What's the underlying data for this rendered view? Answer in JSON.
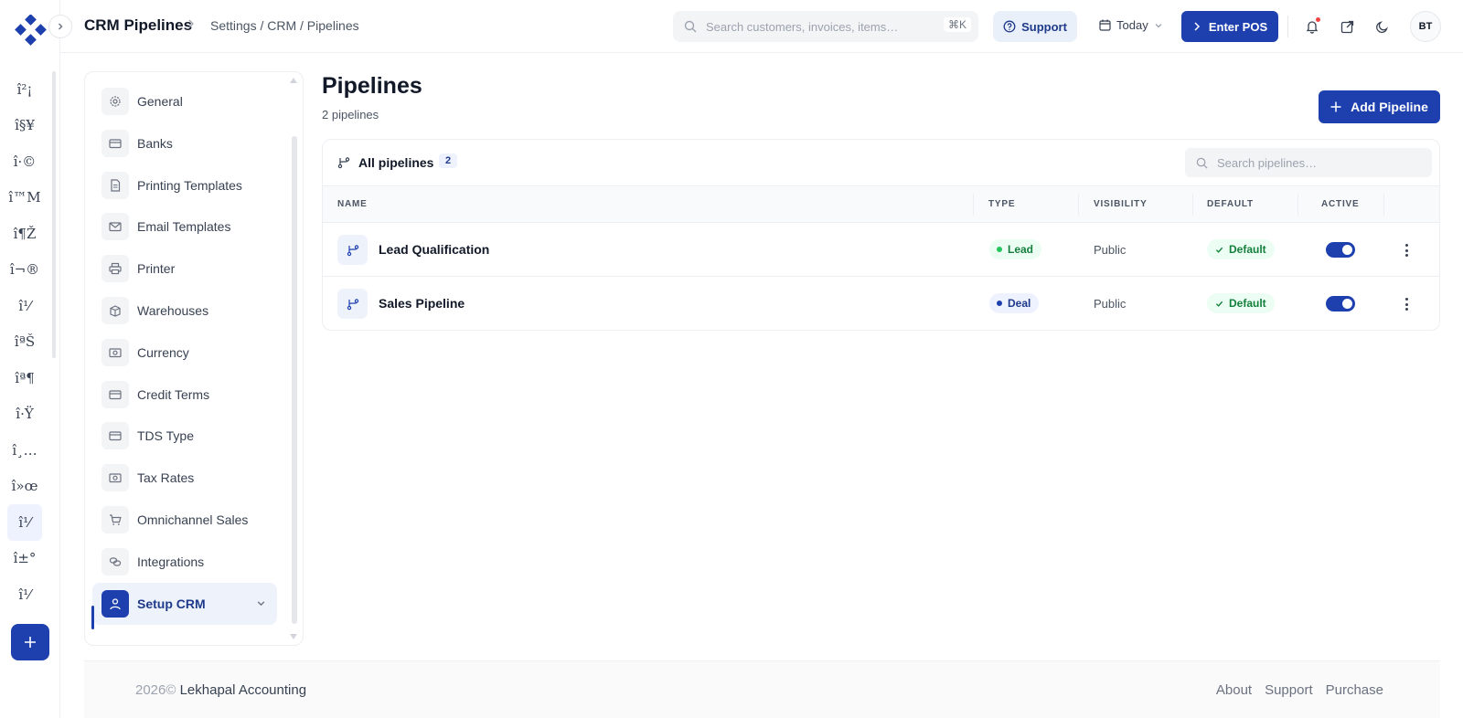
{
  "header": {
    "title": "CRM Pipelines",
    "breadcrumb": "Settings / CRM / Pipelines",
    "search_placeholder": "Search customers, invoices, items…",
    "search_shortcut": "⌘K",
    "support_label": "Support",
    "date_label": "Today",
    "pos_label": "Enter POS",
    "avatar_initials": "BT"
  },
  "rail": {
    "items": [
      "î²¡",
      "î§¥",
      "î·©",
      "î™M",
      "î¶Ž",
      "î¬®",
      "î¹⁄",
      "îªŠ",
      "îª¶",
      "î·Ÿ",
      "î¸…",
      "î»œ",
      "î¹⁄",
      "î±°",
      "î¹⁄"
    ],
    "active_index": 12
  },
  "settings_nav": {
    "items": [
      {
        "label": "General",
        "icon": "gear-icon"
      },
      {
        "label": "Banks",
        "icon": "card-icon"
      },
      {
        "label": "Printing Templates",
        "icon": "document-icon"
      },
      {
        "label": "Email Templates",
        "icon": "mail-icon"
      },
      {
        "label": "Printer",
        "icon": "printer-icon"
      },
      {
        "label": "Warehouses",
        "icon": "box-icon"
      },
      {
        "label": "Currency",
        "icon": "money-icon"
      },
      {
        "label": "Credit Terms",
        "icon": "card-icon"
      },
      {
        "label": "TDS Type",
        "icon": "card-icon"
      },
      {
        "label": "Tax Rates",
        "icon": "money-icon"
      },
      {
        "label": "Omnichannel Sales",
        "icon": "cart-icon"
      },
      {
        "label": "Integrations",
        "icon": "link-icon"
      },
      {
        "label": "Setup CRM",
        "icon": "user-icon"
      }
    ],
    "active_label": "Setup CRM"
  },
  "main": {
    "title": "Pipelines",
    "subtitle": "2 pipelines",
    "add_button": "Add Pipeline",
    "card_title": "All pipelines",
    "count": "2",
    "search_placeholder": "Search pipelines…",
    "columns": [
      "NAME",
      "TYPE",
      "VISIBILITY",
      "DEFAULT",
      "ACTIVE"
    ],
    "rows": [
      {
        "name": "Lead Qualification",
        "type": "Lead",
        "visibility": "Public",
        "default": "Default",
        "active": true
      },
      {
        "name": "Sales Pipeline",
        "type": "Deal",
        "visibility": "Public",
        "default": "Default",
        "active": true
      }
    ]
  },
  "footer": {
    "year": "2026©",
    "company": "Lekhapal Accounting",
    "links": [
      "About",
      "Support",
      "Purchase"
    ]
  },
  "colors": {
    "accent": "#1e40af",
    "success": "#15803d"
  }
}
